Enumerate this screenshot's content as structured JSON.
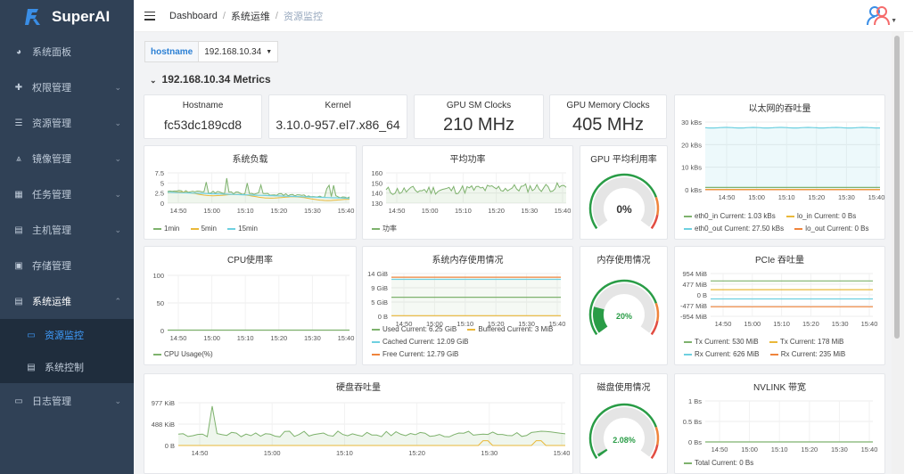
{
  "app": {
    "name": "SuperAI"
  },
  "sidebar": {
    "items": [
      {
        "label": "系统面板",
        "icon": "dashboard-icon"
      },
      {
        "label": "权限管理",
        "icon": "lock-icon",
        "chev": "⌄"
      },
      {
        "label": "资源管理",
        "icon": "list-icon",
        "chev": "⌄"
      },
      {
        "label": "镜像管理",
        "icon": "image-icon",
        "chev": "⌄"
      },
      {
        "label": "任务管理",
        "icon": "grid-icon",
        "chev": "⌄"
      },
      {
        "label": "主机管理",
        "icon": "server-icon",
        "chev": "⌄"
      },
      {
        "label": "存储管理",
        "icon": "storage-icon"
      },
      {
        "label": "系统运维",
        "icon": "ops-icon",
        "chev": "⌃"
      },
      {
        "label": "资源监控",
        "icon": "monitor-icon"
      },
      {
        "label": "系统控制",
        "icon": "control-icon"
      },
      {
        "label": "日志管理",
        "icon": "folder-icon",
        "chev": "⌄"
      }
    ]
  },
  "breadcrumb": {
    "items": [
      "Dashboard",
      "系统运维",
      "资源监控"
    ]
  },
  "variable": {
    "label": "hostname",
    "value": "192.168.10.34"
  },
  "row": {
    "title": "192.168.10.34 Metrics"
  },
  "stats": {
    "hostname": {
      "title": "Hostname",
      "value": "fc53dc189cd8"
    },
    "kernel": {
      "title": "Kernel",
      "value": "3.10.0-957.el7.x86_64"
    },
    "gpu_sm": {
      "title": "GPU SM Clocks",
      "value": "210 MHz"
    },
    "gpu_mem": {
      "title": "GPU Memory Clocks",
      "value": "405 MHz"
    }
  },
  "gauges": {
    "gpu": {
      "title": "GPU 平均利用率",
      "value": "0%",
      "fraction": 0
    },
    "mem": {
      "title": "内存使用情况",
      "value": "20%",
      "fraction": 0.2
    },
    "disk": {
      "title": "磁盘使用情况",
      "value": "2.08%",
      "fraction": 0.0208
    }
  },
  "colors": {
    "green": "#7eb26d",
    "yellow": "#eab839",
    "blue": "#6ed0e0",
    "orange": "#ef843c",
    "red": "#e24d42",
    "gauge_green": "#299c46",
    "gauge_track": "#e5e5e5"
  },
  "times": [
    "14:50",
    "15:00",
    "15:10",
    "15:20",
    "15:30",
    "15:40"
  ],
  "panels": {
    "ethernet": {
      "title": "以太网的吞吐量",
      "yticks": [
        "30 kBs",
        "20 kBs",
        "10 kBs",
        "0 kBs"
      ],
      "legend": [
        "eth0_in  Current: 1.03 kBs",
        "lo_in  Current: 0 Bs",
        "eth0_out  Current: 27.50 kBs",
        "lo_out  Current: 0 Bs"
      ]
    },
    "load": {
      "title": "系统负载",
      "yticks": [
        "7.5",
        "5",
        "2.5",
        "0"
      ],
      "legend": [
        "1min",
        "5min",
        "15min"
      ]
    },
    "power": {
      "title": "平均功率",
      "yticks": [
        "160",
        "150",
        "140",
        "130"
      ],
      "legend": [
        "功率"
      ]
    },
    "cpu": {
      "title": "CPU使用率",
      "yticks": [
        "100",
        "50",
        "0"
      ],
      "legend": [
        "CPU Usage(%)"
      ]
    },
    "sysmem": {
      "title": "系统内存使用情况",
      "yticks": [
        "14 GiB",
        "9 GiB",
        "5 GiB",
        "0 B"
      ],
      "legend": [
        "Used  Current: 6.25 GiB",
        "Buffered  Current: 3 MiB",
        "Cached  Current: 12.09 GiB",
        "Free  Current: 12.79 GiB"
      ]
    },
    "pcie": {
      "title": "PCIe 吞吐量",
      "yticks": [
        "954 MiB",
        "477 MiB",
        "0 B",
        "-477 MiB",
        "-954 MiB"
      ],
      "legend": [
        "Tx  Current: 530 MiB",
        "Tx  Current: 178 MiB",
        "Rx  Current: 626 MiB",
        "Rx  Current: 235 MiB"
      ]
    },
    "disk": {
      "title": "硬盘吞吐量",
      "yticks": [
        "977 KiB",
        "488 KiB",
        "0 B"
      ]
    },
    "nvlink": {
      "title": "NVLINK 带宽",
      "yticks": [
        "1 Bs",
        "0.5 Bs",
        "0 Bs"
      ],
      "legend": [
        "Total  Current: 0 Bs"
      ]
    }
  }
}
